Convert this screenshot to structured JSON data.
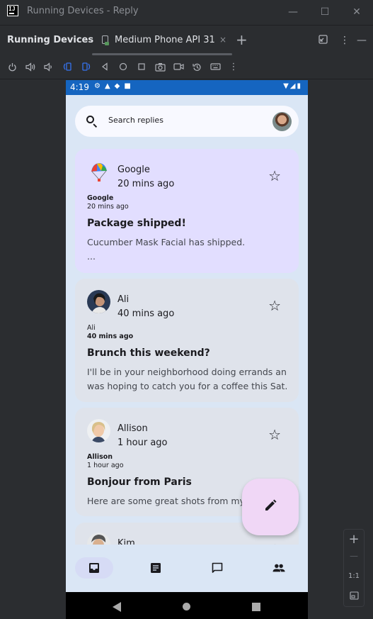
{
  "window": {
    "title": "Running Devices - Reply",
    "minimize": "—",
    "maximize": "☐",
    "close": "✕"
  },
  "tabbar": {
    "tool_title": "Running Devices",
    "device_tab_label": "Medium Phone API 31",
    "device_tab_close": "×",
    "add": "+",
    "more": "⋮",
    "hide": "—"
  },
  "phone": {
    "status_time": "4:19",
    "search_placeholder": "Search replies",
    "emails": [
      {
        "sender": "Google",
        "time": "20 mins ago",
        "subject": "Package shipped!",
        "body": "Cucumber Mask Facial has shipped.",
        "body_more": "...",
        "selected": true
      },
      {
        "sender": "Ali",
        "time": "40 mins ago",
        "subject": "Brunch this weekend?",
        "body_line1": "I'll be in your neighborhood doing errands and",
        "body_line2": "was hoping to catch you for a coffee this Sat..."
      },
      {
        "sender": "Allison",
        "time": "1 hour ago",
        "subject": "Bonjour from Paris",
        "body": "Here are some great shots from my trip..."
      },
      {
        "sender": "Kim"
      }
    ],
    "bottom_nav": [
      "inbox",
      "articles",
      "direct-messages",
      "groups"
    ]
  },
  "zoom": {
    "plus": "+",
    "minus": "—",
    "one_to_one": "1:1"
  },
  "colors": {
    "ide_bg": "#2b2d30",
    "phone_bg": "#dae6f5",
    "status_bar": "#1565c0",
    "selected_card": "#e2deff",
    "card": "#dfe3eb",
    "fab": "#f0d7f6"
  }
}
